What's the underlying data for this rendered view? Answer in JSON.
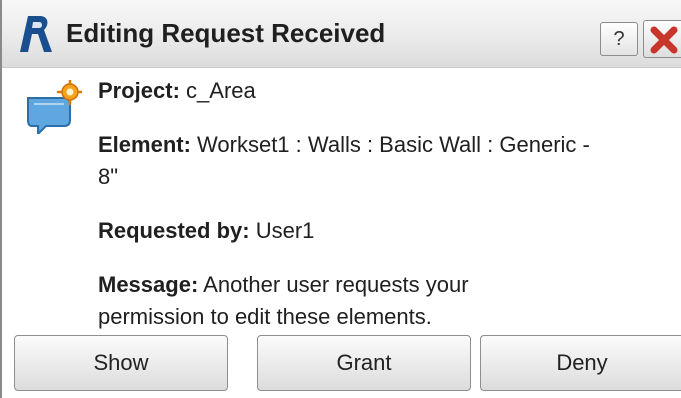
{
  "window": {
    "title": "Editing Request Received",
    "help_label": "?",
    "app_icon": "revit-icon",
    "close_icon": "close-icon"
  },
  "request": {
    "project_label": "Project:",
    "project_value": " c_Area",
    "element_label": "Element:",
    "element_value_line1": " Workset1 : Walls : Basic Wall : Generic -",
    "element_value_line2": "8\"",
    "requested_by_label": "Requested by:",
    "requested_by_value": " User1",
    "message_label": "Message:",
    "message_value_line1": " Another user requests your",
    "message_value_line2": "permission to edit these elements."
  },
  "buttons": {
    "show": "Show",
    "grant": "Grant",
    "deny": "Deny"
  }
}
